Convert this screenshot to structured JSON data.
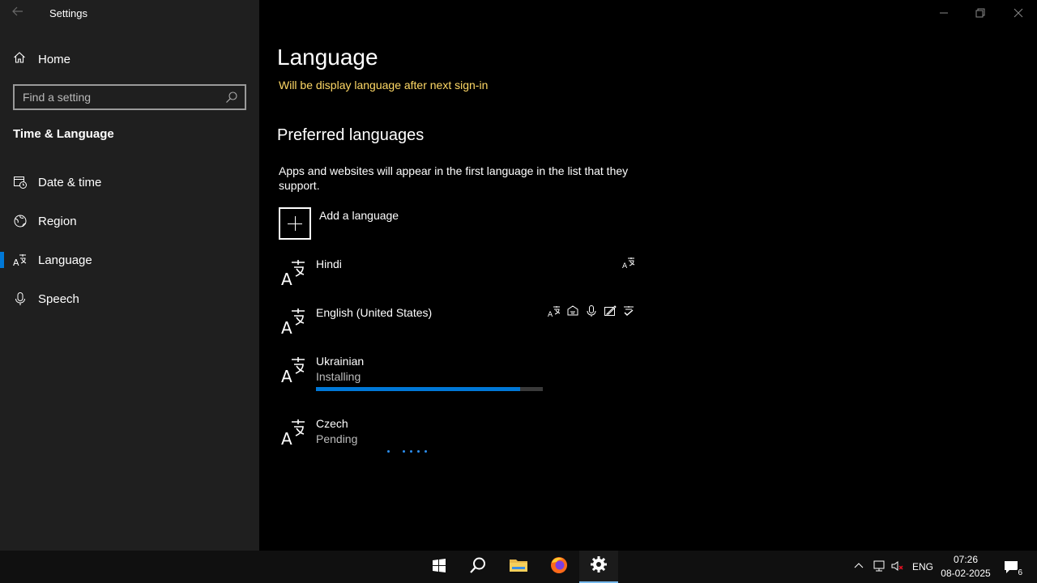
{
  "window": {
    "title": "Settings"
  },
  "sidebar": {
    "home_label": "Home",
    "search_placeholder": "Find a setting",
    "section_title": "Time & Language",
    "items": [
      {
        "label": "Date & time",
        "icon": "calendar-clock-icon"
      },
      {
        "label": "Region",
        "icon": "globe-icon"
      },
      {
        "label": "Language",
        "icon": "language-icon",
        "active": true
      },
      {
        "label": "Speech",
        "icon": "microphone-icon"
      }
    ]
  },
  "main": {
    "title": "Language",
    "notice": "Will be display language after next sign-in",
    "preferred_heading": "Preferred languages",
    "preferred_desc": "Apps and websites will appear in the first language in the list that they support.",
    "add_label": "Add a language",
    "languages": [
      {
        "name": "Hindi",
        "status": "",
        "features": [
          "display-language-icon"
        ]
      },
      {
        "name": "English (United States)",
        "status": "",
        "features": [
          "display-language-icon",
          "text-to-speech-icon",
          "speech-recognition-icon",
          "handwriting-icon",
          "spell-check-icon"
        ]
      },
      {
        "name": "Ukrainian",
        "status": "Installing",
        "progress": 0.9
      },
      {
        "name": "Czech",
        "status": "Pending"
      }
    ]
  },
  "taskbar": {
    "language": "ENG",
    "time": "07:26",
    "date": "08-02-2025",
    "notifications": "6"
  },
  "colors": {
    "accent": "#0078d7",
    "notice": "#ffd966"
  }
}
